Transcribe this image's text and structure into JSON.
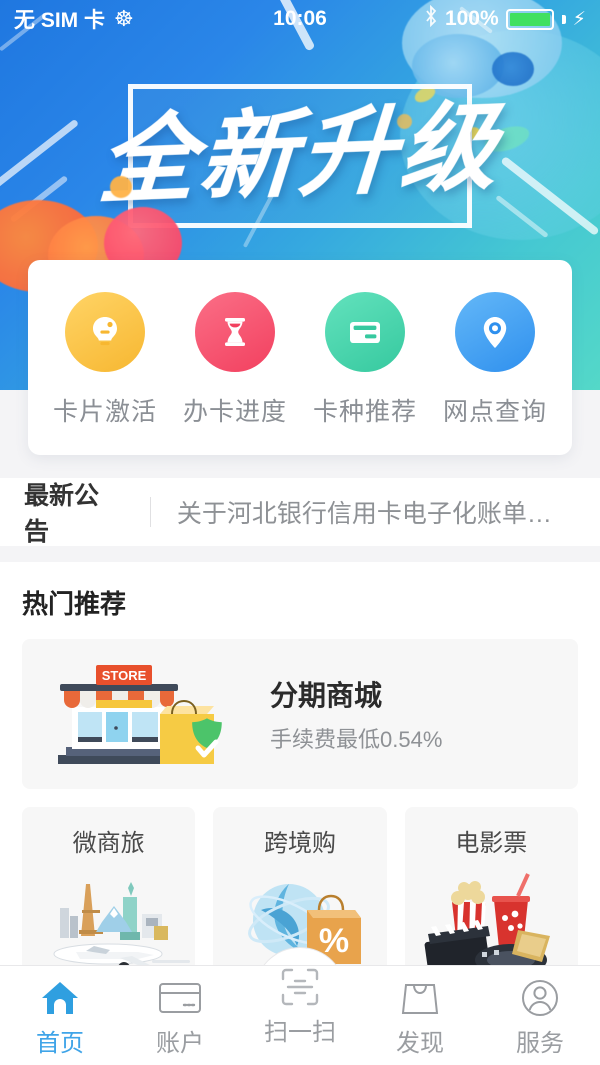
{
  "status_bar": {
    "carrier": "无 SIM 卡",
    "loop_icon": "loop-icon",
    "time": "10:06",
    "bluetooth_icon": "bluetooth-icon",
    "battery_percent": "100%",
    "battery_color": "#40e060",
    "charging_icon": "charging-bolt-icon"
  },
  "banner": {
    "title": "全新升级",
    "gradient_from": "#1f77e0",
    "gradient_to": "#54d8c8"
  },
  "quick_actions": {
    "items": [
      {
        "label": "卡片激活",
        "icon": "lightbulb-icon",
        "color": "#f7b731"
      },
      {
        "label": "办卡进度",
        "icon": "hourglass-icon",
        "color": "#f2405f"
      },
      {
        "label": "卡种推荐",
        "icon": "credit-card-icon",
        "color": "#36c99f"
      },
      {
        "label": "网点查询",
        "icon": "location-pin-icon",
        "color": "#2f90ee"
      }
    ]
  },
  "notice": {
    "title": "最新公告",
    "text": "关于河北银行信用卡电子化账单服…"
  },
  "hot": {
    "title": "热门推荐",
    "promo": {
      "heading": "分期商城",
      "subheading": "手续费最低0.54%",
      "art": "storefront-illustration",
      "sign_text": "STORE"
    },
    "tiles": [
      {
        "label": "微商旅",
        "art": "travel-illustration"
      },
      {
        "label": "跨境购",
        "art": "globe-discount-illustration",
        "badge": "%"
      },
      {
        "label": "电影票",
        "art": "movie-illustration"
      }
    ]
  },
  "tabbar": {
    "active_color": "#3fa4e8",
    "inactive_color": "#9a9da1",
    "items": [
      {
        "label": "首页",
        "icon": "home-icon",
        "active": true
      },
      {
        "label": "账户",
        "icon": "card-icon",
        "active": false
      },
      {
        "label": "扫一扫",
        "icon": "scan-icon",
        "active": false
      },
      {
        "label": "发现",
        "icon": "bag-icon",
        "active": false
      },
      {
        "label": "服务",
        "icon": "person-icon",
        "active": false
      }
    ]
  }
}
